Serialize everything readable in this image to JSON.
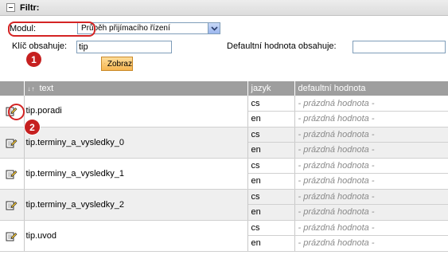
{
  "filter": {
    "title": "Filtr:",
    "module_label": "Modul:",
    "module_selected": "Průběh přijímacího řízení",
    "key_label": "Klíč obsahuje:",
    "key_value": "tip",
    "default_label": "Defaultní hodnota obsahuje:",
    "default_value": "",
    "search_button": "Zobraz"
  },
  "markers": {
    "one": "1",
    "two": "2"
  },
  "table": {
    "headers": {
      "sort": "↓↑",
      "text": "text",
      "lang": "jazyk",
      "default": "defaultní hodnota"
    },
    "rows": [
      {
        "key": "tip.poradi",
        "langs": [
          {
            "lang": "cs",
            "value": "- prázdná hodnota -"
          },
          {
            "lang": "en",
            "value": "- prázdná hodnota -"
          }
        ]
      },
      {
        "key": "tip.terminy_a_vysledky_0",
        "langs": [
          {
            "lang": "cs",
            "value": "- prázdná hodnota -"
          },
          {
            "lang": "en",
            "value": "- prázdná hodnota -"
          }
        ]
      },
      {
        "key": "tip.terminy_a_vysledky_1",
        "langs": [
          {
            "lang": "cs",
            "value": "- prázdná hodnota -"
          },
          {
            "lang": "en",
            "value": "- prázdná hodnota -"
          }
        ]
      },
      {
        "key": "tip.terminy_a_vysledky_2",
        "langs": [
          {
            "lang": "cs",
            "value": "- prázdná hodnota -"
          },
          {
            "lang": "en",
            "value": "- prázdná hodnota -"
          }
        ]
      },
      {
        "key": "tip.uvod",
        "langs": [
          {
            "lang": "cs",
            "value": "- prázdná hodnota -"
          },
          {
            "lang": "en",
            "value": "- prázdná hodnota -"
          }
        ]
      }
    ]
  },
  "colors": {
    "header_bg": "#9e9e9e",
    "annotation_red": "#c62020",
    "button_orange": "#f6b550"
  },
  "icons": {
    "collapse": "collapse-minus-icon",
    "edit": "edit-pencil-icon",
    "search": "search-button-icon",
    "dropdown": "chevron-down-icon"
  }
}
